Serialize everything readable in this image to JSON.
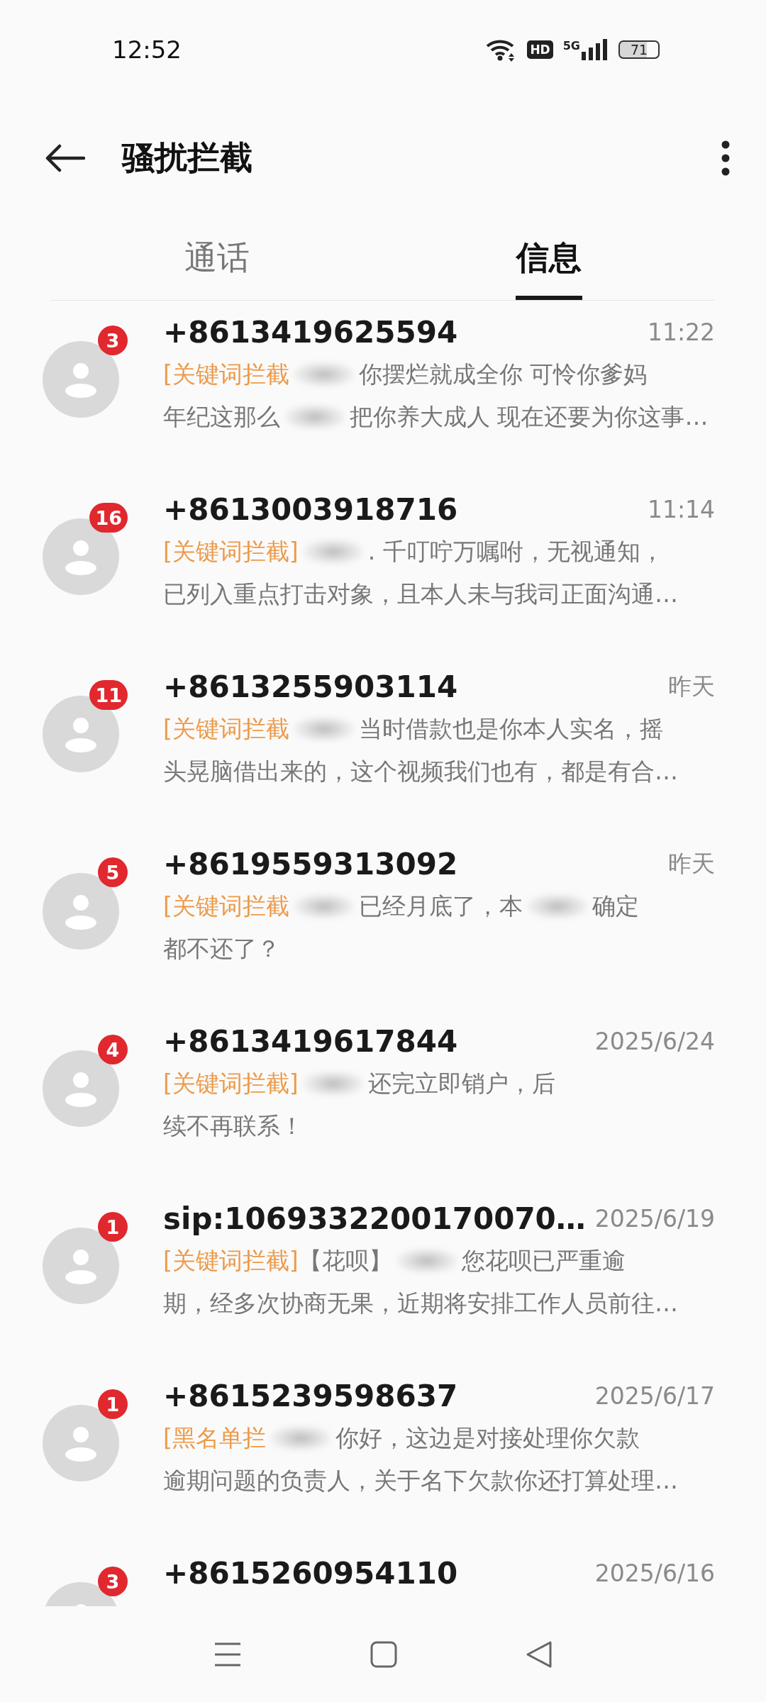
{
  "status_bar": {
    "time": "12:52",
    "hd": "HD",
    "network": "5G",
    "battery": "71"
  },
  "header": {
    "title": "骚扰拦截"
  },
  "tabs": [
    {
      "label": "通话",
      "selected": false
    },
    {
      "label": "信息",
      "selected": true
    }
  ],
  "messages": [
    {
      "sender": "+8613419625594",
      "time": "11:22",
      "unread": "3",
      "lines": [
        [
          {
            "kind": "tag",
            "text": "[关键词拦截"
          },
          {
            "kind": "redacted"
          },
          {
            "kind": "text",
            "text": "你摆烂就成全你 可怜你爹妈"
          }
        ],
        [
          {
            "kind": "text",
            "text": "年纪这那么"
          },
          {
            "kind": "redacted"
          },
          {
            "kind": "text",
            "text": "把你养大成人 现在还要为你这事…"
          }
        ]
      ]
    },
    {
      "sender": "+8613003918716",
      "time": "11:14",
      "unread": "16",
      "lines": [
        [
          {
            "kind": "tag",
            "text": "[关键词拦截]"
          },
          {
            "kind": "redacted"
          },
          {
            "kind": "text",
            "text": ". 千叮咛万嘱咐，无视通知，"
          }
        ],
        [
          {
            "kind": "text",
            "text": "已列入重点打击对象，且本人未与我司正面沟通…"
          }
        ]
      ]
    },
    {
      "sender": "+8613255903114",
      "time": "昨天",
      "unread": "11",
      "lines": [
        [
          {
            "kind": "tag",
            "text": "[关键词拦截"
          },
          {
            "kind": "redacted"
          },
          {
            "kind": "text",
            "text": "当时借款也是你本人实名，摇"
          }
        ],
        [
          {
            "kind": "text",
            "text": "头晃脑借出来的，这个视频我们也有，都是有合…"
          }
        ]
      ]
    },
    {
      "sender": "+8619559313092",
      "time": "昨天",
      "unread": "5",
      "lines": [
        [
          {
            "kind": "tag",
            "text": "[关键词拦截"
          },
          {
            "kind": "redacted"
          },
          {
            "kind": "text",
            "text": "已经月底了，本"
          },
          {
            "kind": "redacted"
          },
          {
            "kind": "text",
            "text": "确定"
          }
        ],
        [
          {
            "kind": "text",
            "text": "都不还了？"
          }
        ]
      ]
    },
    {
      "sender": "+8613419617844",
      "time": "2025/6/24",
      "unread": "4",
      "lines": [
        [
          {
            "kind": "tag",
            "text": "[关键词拦截]"
          },
          {
            "kind": "redacted"
          },
          {
            "kind": "text",
            "text": "还完立即销户，后"
          }
        ],
        [
          {
            "kind": "text",
            "text": "续不再联系！"
          }
        ]
      ]
    },
    {
      "sender": "sip:1069332200170070…",
      "time": "2025/6/19",
      "unread": "1",
      "lines": [
        [
          {
            "kind": "tag",
            "text": "[关键词拦截]"
          },
          {
            "kind": "text",
            "text": "【花呗】"
          },
          {
            "kind": "redacted"
          },
          {
            "kind": "text",
            "text": "您花呗已严重逾"
          }
        ],
        [
          {
            "kind": "text",
            "text": "期，经多次协商无果，近期将安排工作人员前往…"
          }
        ]
      ]
    },
    {
      "sender": "+8615239598637",
      "time": "2025/6/17",
      "unread": "1",
      "lines": [
        [
          {
            "kind": "tag",
            "text": "[黑名单拦"
          },
          {
            "kind": "redacted"
          },
          {
            "kind": "text",
            "text": "你好，这边是对接处理你欠款"
          }
        ],
        [
          {
            "kind": "text",
            "text": "逾期问题的负责人，关于名下欠款你还打算处理…"
          }
        ]
      ]
    },
    {
      "sender": "+8615260954110",
      "time": "2025/6/16",
      "unread": "3"
    }
  ]
}
